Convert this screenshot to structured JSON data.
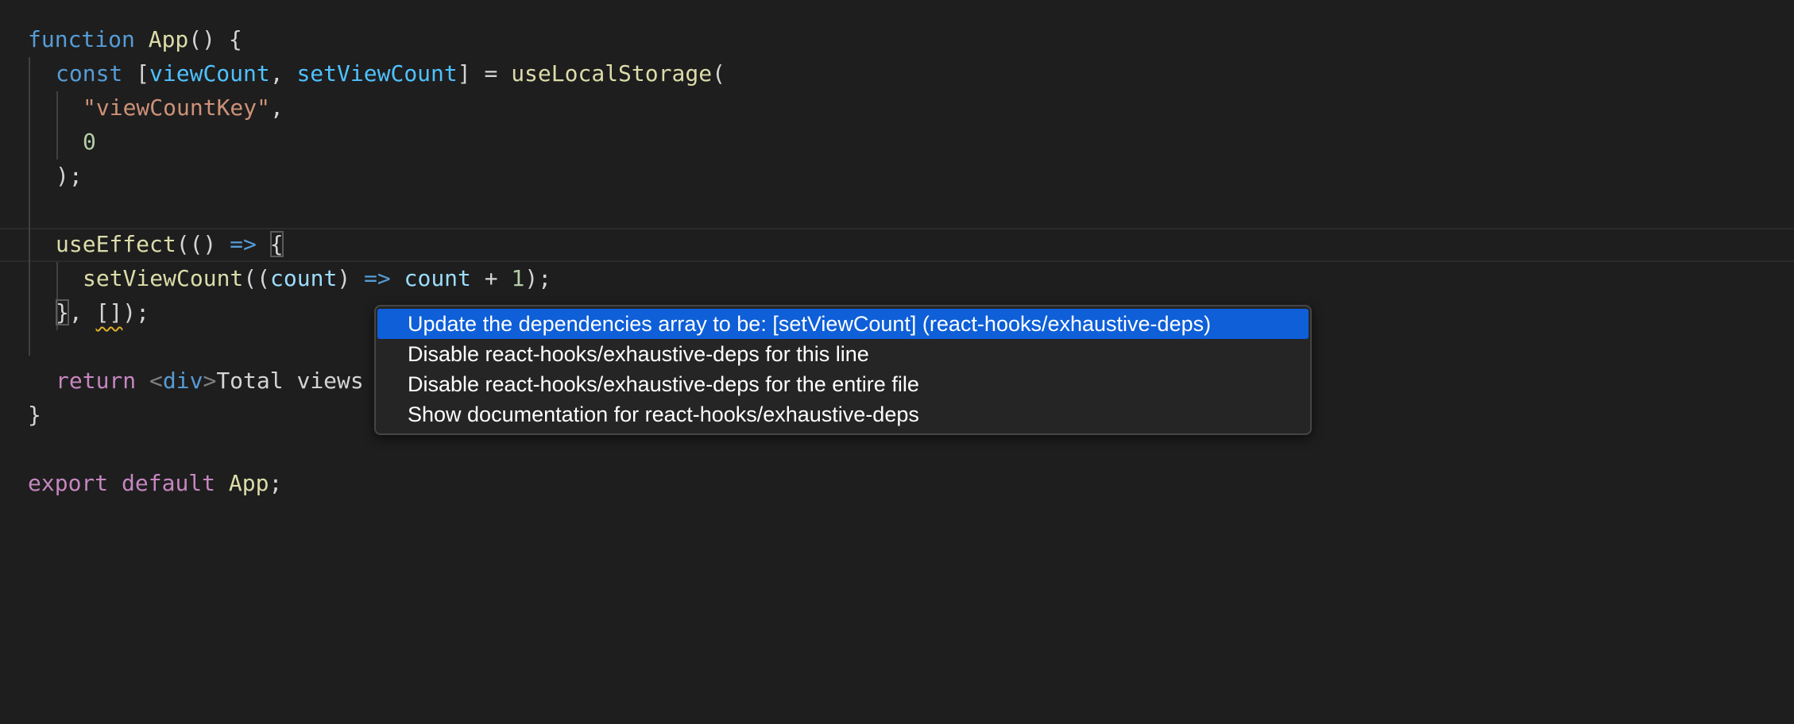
{
  "editor": {
    "lines": {
      "l1": {
        "kw": "function",
        "name": "App",
        "rest": "() {"
      },
      "l2": {
        "kw": "const",
        "open": " [",
        "v1": "viewCount",
        "comma": ", ",
        "v2": "setViewCount",
        "close": "] = ",
        "fn": "useLocalStorage",
        "paren": "("
      },
      "l3": {
        "str": "\"viewCountKey\"",
        "comma": ","
      },
      "l4": {
        "num": "0"
      },
      "l5": {
        "text": ");"
      },
      "l7": {
        "fn": "useEffect",
        "paren": "(() ",
        "arrow": "=>",
        "space": " ",
        "brace": "{"
      },
      "l8": {
        "fn": "setViewCount",
        "open": "((",
        "param": "count",
        "close": ") ",
        "arrow": "=>",
        "space": " ",
        "var": "count",
        "plus": " + ",
        "num": "1",
        "end": ");"
      },
      "l9": {
        "brace": "}",
        "comma": ", ",
        "deps": "[]",
        "end": ");"
      },
      "l11": {
        "kw": "return",
        "sp": " ",
        "lt": "<",
        "tag": "div",
        "gt": ">",
        "text": "Total views"
      },
      "l12": {
        "text": "}"
      },
      "l14": {
        "kw1": "export",
        "kw2": "default",
        "name": "App",
        "end": ";"
      }
    }
  },
  "quickfix": {
    "items": [
      {
        "label": "Update the dependencies array to be: [setViewCount] (react-hooks/exhaustive-deps)"
      },
      {
        "label": "Disable react-hooks/exhaustive-deps for this line"
      },
      {
        "label": "Disable react-hooks/exhaustive-deps for the entire file"
      },
      {
        "label": "Show documentation for react-hooks/exhaustive-deps"
      }
    ]
  },
  "colors": {
    "background": "#1e1e1e",
    "keyword": "#569cd6",
    "control_keyword": "#c586c0",
    "function": "#dcdcaa",
    "variable": "#9cdcfe",
    "string": "#ce9178",
    "number": "#b5cea8",
    "selection": "#0e5fd8",
    "warning_squiggle": "#e0b028"
  }
}
